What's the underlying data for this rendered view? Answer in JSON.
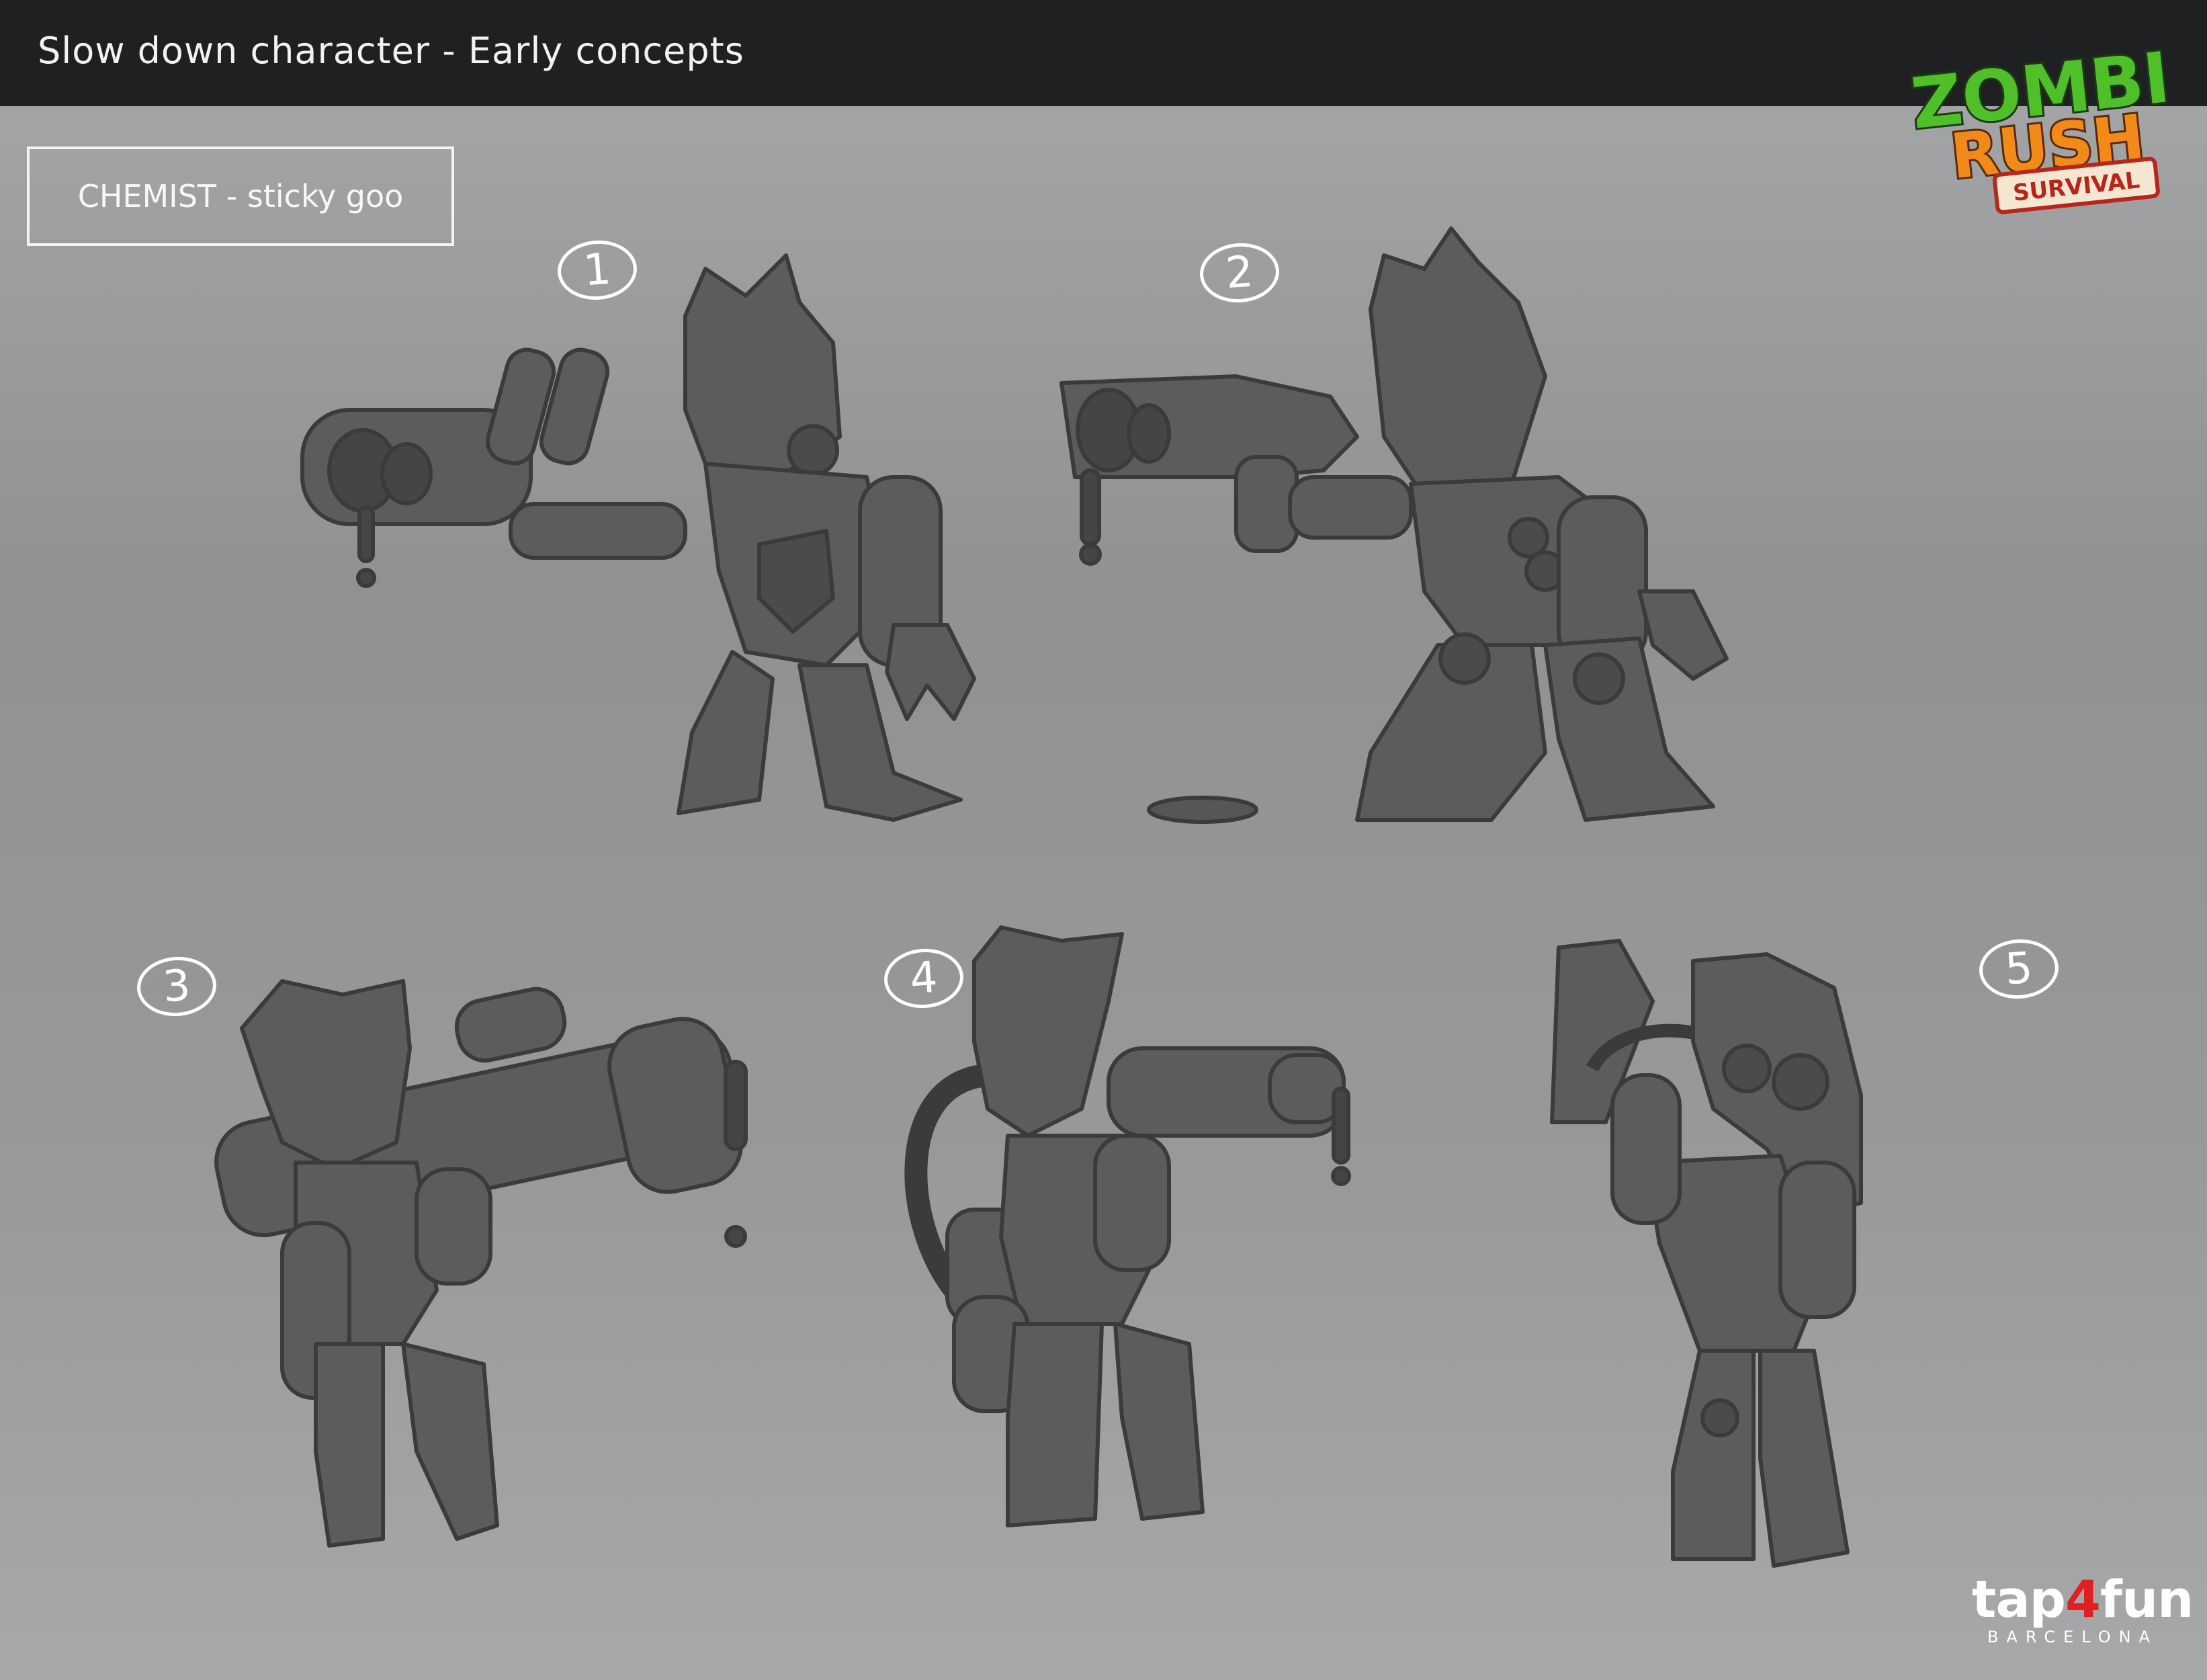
{
  "header": {
    "title": "Slow down character - Early concepts"
  },
  "variant": {
    "label": "CHEMIST - sticky goo"
  },
  "concepts": [
    {
      "number": "1"
    },
    {
      "number": "2"
    },
    {
      "number": "3"
    },
    {
      "number": "4"
    },
    {
      "number": "5"
    }
  ],
  "logo": {
    "line1": "ZOMBIE",
    "line2": "RUSH",
    "line3": "SURVIVAL"
  },
  "brand": {
    "part1": "tap",
    "part2": "4",
    "part3": "fun",
    "sub": "BARCELONA"
  },
  "colors": {
    "topbar": "#1f2022",
    "sketch_fill": "#5b5c5e",
    "sketch_line": "#3a3b3d",
    "logo_green": "#4fbf2a",
    "logo_orange": "#f28a1a",
    "brand_red": "#e02020"
  }
}
